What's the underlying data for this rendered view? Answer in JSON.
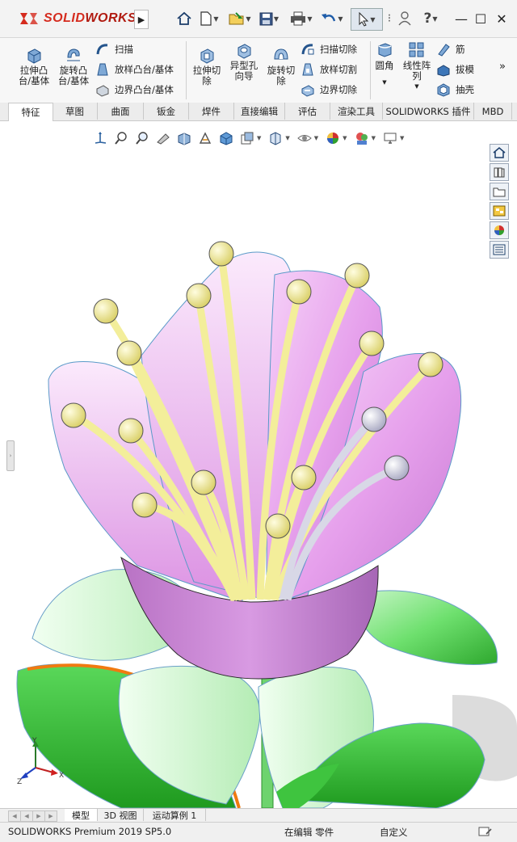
{
  "app": {
    "logo_prefix": "3DS",
    "logo_solid": "SOLID",
    "logo_works": "WORKS",
    "brand_color": "#d52b1e"
  },
  "quick_access": [
    {
      "name": "home-icon"
    },
    {
      "name": "new-document-icon"
    },
    {
      "name": "open-icon"
    },
    {
      "name": "save-icon"
    },
    {
      "name": "print-icon"
    },
    {
      "name": "undo-icon"
    },
    {
      "name": "select-pointer-icon"
    },
    {
      "name": "user-icon"
    },
    {
      "name": "help-icon"
    }
  ],
  "window_controls": {
    "minimize": "—",
    "maximize": "☐",
    "close": "✕"
  },
  "ribbon": {
    "extrude_boss": "拉伸凸\n台/基体",
    "revolve_boss": "旋转凸\n台/基体",
    "sweep": "扫描",
    "loft_boss": "放样凸台/基体",
    "boundary_boss": "边界凸台/基体",
    "extrude_cut": "拉伸切\n除",
    "hole_wizard": "异型孔\n向导",
    "revolve_cut": "旋转切\n除",
    "swept_cut": "扫描切除",
    "lofted_cut": "放样切割",
    "boundary_cut": "边界切除",
    "fillet": "圆角",
    "linear_pattern": "线性阵\n列",
    "rib": "筋",
    "draft": "拔模",
    "shell": "抽壳",
    "more": "»"
  },
  "tabs": [
    "特征",
    "草图",
    "曲面",
    "钣金",
    "焊件",
    "直接编辑",
    "评估",
    "渲染工具",
    "SOLIDWORKS 插件",
    "MBD"
  ],
  "active_tab": "特征",
  "bottom_tabs": [
    "模型",
    "3D 视图",
    "运动算例 1"
  ],
  "active_bottom_tab": "模型",
  "status": {
    "product": "SOLIDWORKS Premium 2019 SP5.0",
    "mode": "在编辑 零件",
    "units": "自定义"
  },
  "triad": {
    "y": "Y",
    "x": "X",
    "z": "Z"
  },
  "colors": {
    "petal": "#e9a6ee",
    "stamen": "#f3ee9a",
    "anther_gray": "#dcdce6",
    "leaf": "#4fd44f",
    "highlight_edge": "#f07a10"
  }
}
